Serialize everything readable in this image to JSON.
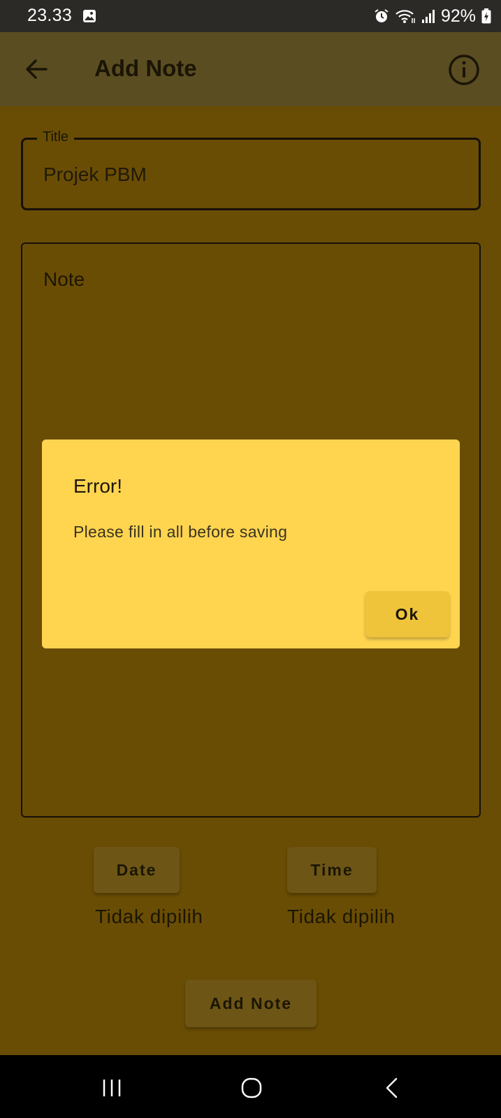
{
  "status_bar": {
    "time": "23.33",
    "battery": "92%"
  },
  "app_bar": {
    "title": "Add Note"
  },
  "title_field": {
    "label": "Title",
    "value": "Projek PBM"
  },
  "note_field": {
    "placeholder": "Note"
  },
  "date_button": {
    "label": "Date",
    "status": "Tidak dipilih"
  },
  "time_button": {
    "label": "Time",
    "status": "Tidak dipilih"
  },
  "add_note_button": {
    "label": "Add Note"
  },
  "dialog": {
    "title": "Error!",
    "message": "Please fill in all before saving",
    "ok_label": "Ok"
  },
  "colors": {
    "background": "#6a4d04",
    "app_bar": "#5b4d22",
    "dialog": "#ffd54f",
    "ok_button": "#efc43a"
  }
}
